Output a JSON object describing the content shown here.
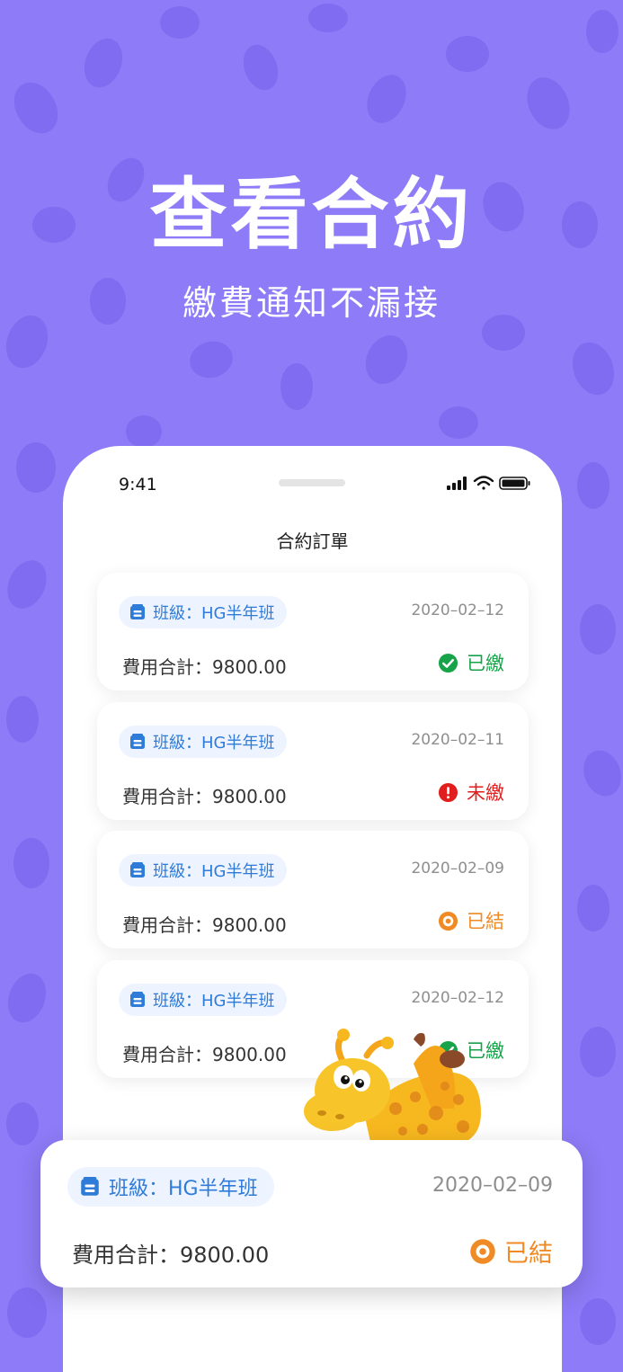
{
  "hero": {
    "title": "查看合約",
    "subtitle": "繳費通知不漏接"
  },
  "phone": {
    "status_time": "9:41",
    "nav_title": "合約訂單"
  },
  "colors": {
    "background": "#8d7bf7",
    "chip_text": "#2f7bd8",
    "chip_bg": "#edf4ff",
    "paid": "#17a34a",
    "unpaid": "#e01e1e",
    "settled": "#f08a24"
  },
  "orders": [
    {
      "class_label": "班級：HG半年班",
      "date": "2020–02–12",
      "total": "費用合計：9800.00",
      "status": "已繳",
      "status_icon": "check-circle-icon"
    },
    {
      "class_label": "班級：HG半年班",
      "date": "2020–02–11",
      "total": "費用合計：9800.00",
      "status": "未繳",
      "status_icon": "alert-circle-icon"
    },
    {
      "class_label": "班級：HG半年班",
      "date": "2020–02–09",
      "total": "費用合計：9800.00",
      "status": "已結",
      "status_icon": "target-circle-icon"
    },
    {
      "class_label": "班級：HG半年班",
      "date": "2020–02–12",
      "total": "費用合計：9800.00",
      "status": "已繳",
      "status_icon": "check-circle-icon"
    }
  ],
  "highlight_order": {
    "class_label": "班級：HG半年班",
    "date": "2020–02–09",
    "total": "費用合計：9800.00",
    "status": "已結",
    "status_icon": "target-circle-icon"
  }
}
